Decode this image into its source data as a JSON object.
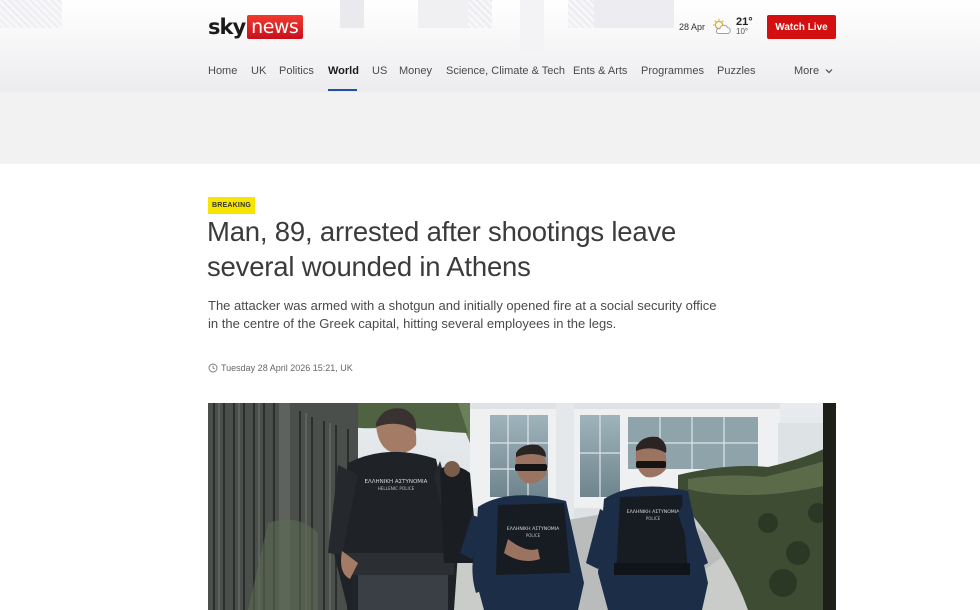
{
  "brand": {
    "sky": "sky",
    "news": "news"
  },
  "weather": {
    "date": "28 Apr",
    "icon": "partly-cloudy-icon",
    "high": "21°",
    "low": "10°"
  },
  "header": {
    "watch_live": "Watch Live"
  },
  "nav": {
    "items": [
      {
        "label": "Home"
      },
      {
        "label": "UK"
      },
      {
        "label": "Politics"
      },
      {
        "label": "World",
        "active": true
      },
      {
        "label": "US"
      },
      {
        "label": "Money"
      },
      {
        "label": "Science, Climate & Tech"
      },
      {
        "label": "Ents & Arts"
      },
      {
        "label": "Programmes"
      },
      {
        "label": "Puzzles"
      }
    ],
    "more": "More"
  },
  "article": {
    "badge": "BREAKING",
    "headline_line1": "Man, 89, arrested after shootings leave",
    "headline_line2": "several wounded in Athens",
    "standfirst_line1": "The attacker was armed with a shotgun and initially opened fire at a social security office",
    "standfirst_line2": "in the centre of the Greek capital, hitting several employees in the legs.",
    "timestamp": "Tuesday 28 April 2026 15:21, UK"
  },
  "photo": {
    "vest_left": "ΕΛΛΗΝΙΚΗ ΑΣΤΥΝΟΜΙΑ",
    "vest_left_sub": "HELLENIC POLICE",
    "vest_mid": "ΕΛΛΗΝΙΚΗ ΑΣΤΥΝΟΜΙΑ",
    "vest_mid_sub": "POLICE",
    "vest_right": "ΕΛΛΗΝΙΚΗ ΑΣΤΥΝΟΜΙΑ",
    "vest_right_sub": "POLICE"
  },
  "colors": {
    "accent": "#d40f0f",
    "nav_underline": "#1f4fa8",
    "breaking": "#f6e500"
  }
}
